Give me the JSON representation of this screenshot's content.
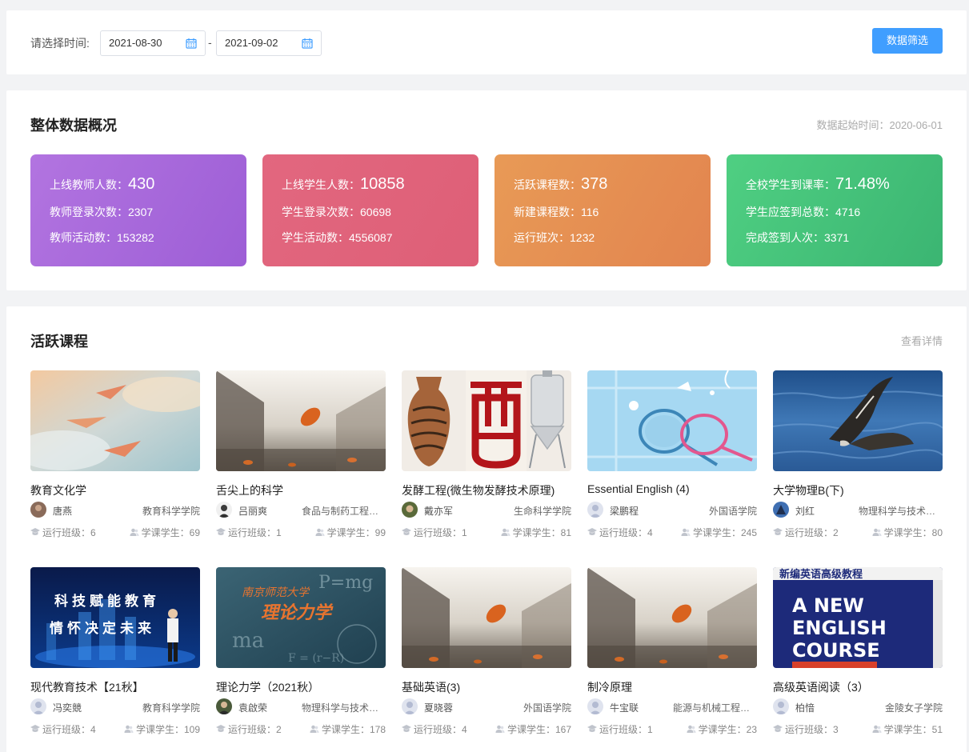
{
  "filter": {
    "label": "请选择时间:",
    "start_date": "2021-08-30",
    "separator": "-",
    "end_date": "2021-09-02",
    "button_label": "数据筛选"
  },
  "overview": {
    "title": "整体数据概况",
    "start_note": "数据起始时间：2020-06-01",
    "cards": [
      {
        "l1": "上线教师人数：",
        "v1": "430",
        "l2": "教师登录次数：",
        "v2": "2307",
        "l3": "教师活动数：",
        "v3": "153282"
      },
      {
        "l1": "上线学生人数：",
        "v1": "10858",
        "l2": "学生登录次数：",
        "v2": "60698",
        "l3": "学生活动数：",
        "v3": "4556087"
      },
      {
        "l1": "活跃课程数：",
        "v1": "378",
        "l2": "新建课程数：",
        "v2": "116",
        "l3": "运行班次：",
        "v3": "1232"
      },
      {
        "l1": "全校学生到课率：",
        "v1": "71.48%",
        "l2": "学生应签到总数：",
        "v2": "4716",
        "l3": "完成签到人次：",
        "v3": "3371"
      }
    ],
    "card_colors": [
      "#a86ade",
      "#e0647b",
      "#e68f52",
      "#45c47a"
    ]
  },
  "courses": {
    "title": "活跃课程",
    "more_label": "查看详情",
    "class_label": "运行班级：",
    "student_label": "学课学生：",
    "items": [
      {
        "name": "教育文化学",
        "teacher": "唐燕",
        "college": "教育科学学院",
        "classes": "6",
        "students": "69"
      },
      {
        "name": "舌尖上的科学",
        "teacher": "吕丽爽",
        "college": "食品与制药工程学院",
        "classes": "1",
        "students": "99"
      },
      {
        "name": "发酵工程(微生物发酵技术原理)",
        "teacher": "戴亦军",
        "college": "生命科学学院",
        "classes": "1",
        "students": "81"
      },
      {
        "name": "Essential English (4)",
        "teacher": "梁鹏程",
        "college": "外国语学院",
        "classes": "4",
        "students": "245"
      },
      {
        "name": "大学物理B(下)",
        "teacher": "刘红",
        "college": "物理科学与技术学院",
        "classes": "2",
        "students": "80"
      },
      {
        "name": "现代教育技术【21秋】",
        "teacher": "冯奕競",
        "college": "教育科学学院",
        "classes": "4",
        "students": "109"
      },
      {
        "name": "理论力学（2021秋）",
        "teacher": "袁啟荣",
        "college": "物理科学与技术学院",
        "classes": "2",
        "students": "178"
      },
      {
        "name": "基础英语(3)",
        "teacher": "夏晓蓉",
        "college": "外国语学院",
        "classes": "4",
        "students": "167"
      },
      {
        "name": "制冷原理",
        "teacher": "牛宝联",
        "college": "能源与机械工程学院",
        "classes": "1",
        "students": "23"
      },
      {
        "name": "高级英语阅读（3）",
        "teacher": "柏愔",
        "college": "金陵女子学院",
        "classes": "3",
        "students": "51"
      }
    ],
    "cover_texts": {
      "tech_line1": "科技赋能教育",
      "tech_line2": "情怀决定未来",
      "mech_line1": "南京师范大学",
      "mech_line2": "理论力学",
      "book_top": "新编英语高级教程",
      "book_line1": "A NEW",
      "book_line2": "ENGLISH",
      "book_line3": "COURSE"
    }
  }
}
